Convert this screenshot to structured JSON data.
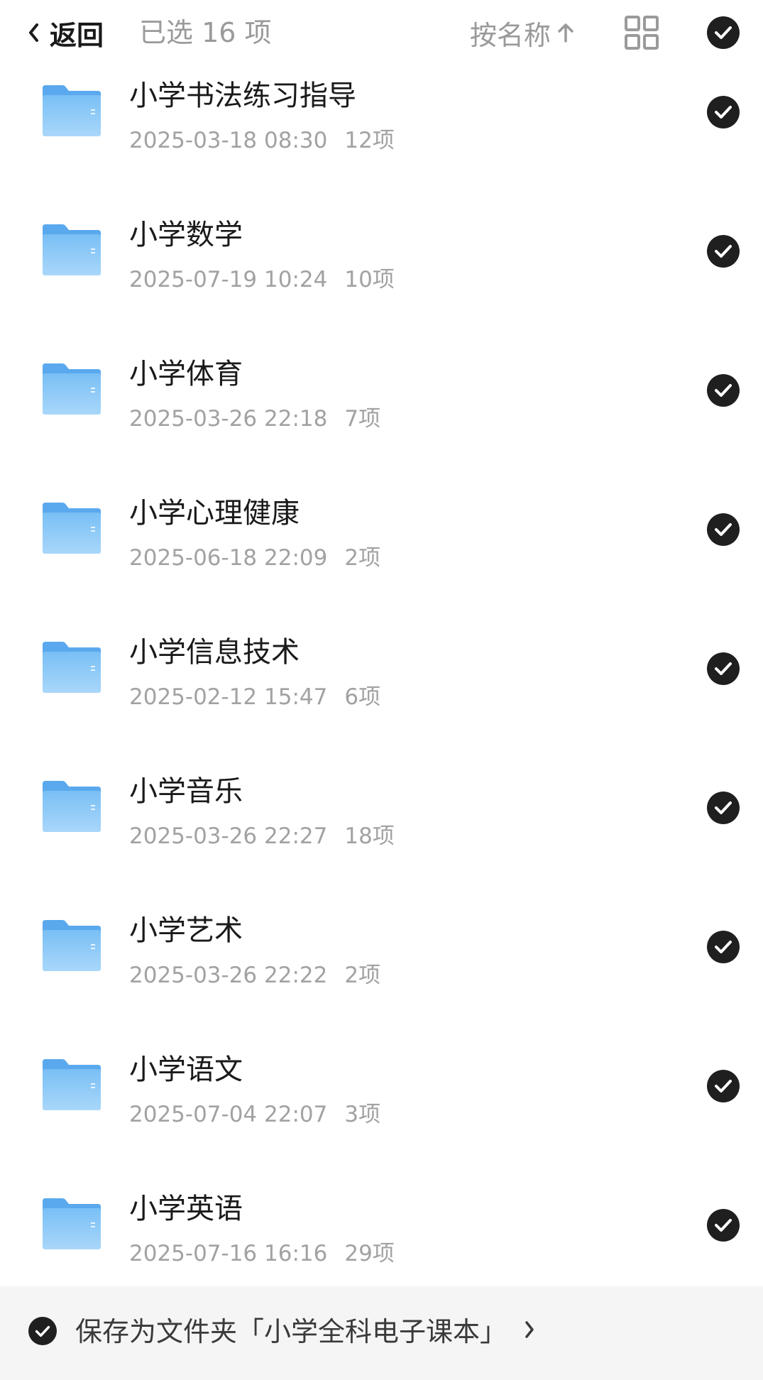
{
  "header": {
    "back_label": "返回",
    "selected_text": "已选 16 项",
    "sort_label": "按名称",
    "sort_direction_icon": "arrow-up-icon",
    "view_icon": "grid-view-icon",
    "select_all_icon": "check-circle-icon"
  },
  "folders": [
    {
      "name": "小学书法练习指导",
      "date": "2025-03-18 08:30",
      "count": "12项",
      "selected": true
    },
    {
      "name": "小学数学",
      "date": "2025-07-19 10:24",
      "count": "10项",
      "selected": true
    },
    {
      "name": "小学体育",
      "date": "2025-03-26 22:18",
      "count": "7项",
      "selected": true
    },
    {
      "name": "小学心理健康",
      "date": "2025-06-18 22:09",
      "count": "2项",
      "selected": true
    },
    {
      "name": "小学信息技术",
      "date": "2025-02-12 15:47",
      "count": "6项",
      "selected": true
    },
    {
      "name": "小学音乐",
      "date": "2025-03-26 22:27",
      "count": "18项",
      "selected": true
    },
    {
      "name": "小学艺术",
      "date": "2025-03-26 22:22",
      "count": "2项",
      "selected": true
    },
    {
      "name": "小学语文",
      "date": "2025-07-04 22:07",
      "count": "3项",
      "selected": true
    },
    {
      "name": "小学英语",
      "date": "2025-07-16 16:16",
      "count": "29项",
      "selected": true
    }
  ],
  "footer": {
    "save_label": "保存为文件夹「小学全科电子课本」",
    "chevron_icon": "chevron-right-icon",
    "checked": true
  },
  "colors": {
    "folder_blue": "#5aa9ee",
    "check_dark": "#1f1f1f",
    "muted_text": "#9a9a9a"
  }
}
